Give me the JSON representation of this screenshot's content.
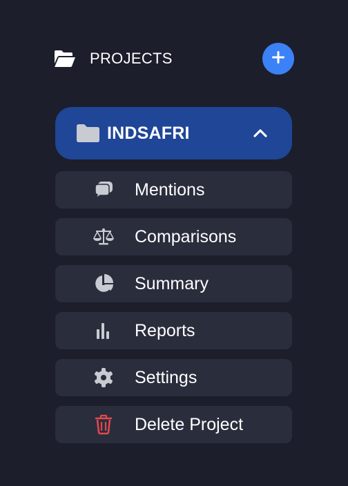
{
  "header": {
    "title": "PROJECTS",
    "folder_icon": "folder-open-icon",
    "add_icon": "plus-icon"
  },
  "project": {
    "name": "INDSAFRI",
    "folder_icon": "folder-icon",
    "toggle_icon": "chevron-up-icon",
    "expanded": true
  },
  "menu": {
    "items": [
      {
        "label": "Mentions",
        "icon": "comments-icon"
      },
      {
        "label": "Comparisons",
        "icon": "scale-icon"
      },
      {
        "label": "Summary",
        "icon": "pie-chart-icon"
      },
      {
        "label": "Reports",
        "icon": "bar-chart-icon"
      },
      {
        "label": "Settings",
        "icon": "gear-icon"
      },
      {
        "label": "Delete Project",
        "icon": "trash-icon"
      }
    ]
  },
  "colors": {
    "background": "#1c1e2c",
    "accent": "#3b82f6",
    "project_active": "#1f4697",
    "menu_item_bg": "#2a2d3c",
    "icon_gray": "#c9cbd2",
    "danger": "#e5484d"
  }
}
